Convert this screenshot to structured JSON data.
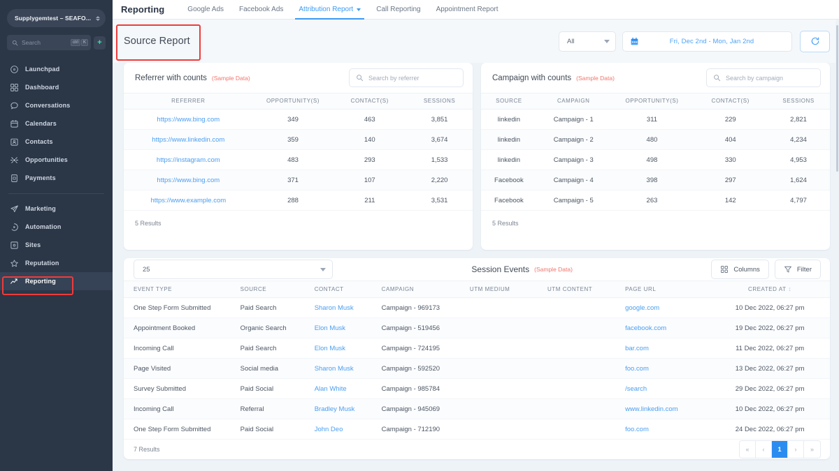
{
  "sidebar": {
    "org_name": "Supplygemtest – SEAFO...",
    "search_placeholder": "Search",
    "kbd": [
      "ctrl",
      "K"
    ],
    "add_label": "+",
    "items": [
      {
        "label": "Launchpad",
        "icon": "rocket-icon"
      },
      {
        "label": "Dashboard",
        "icon": "grid-icon"
      },
      {
        "label": "Conversations",
        "icon": "chat-bubble-icon"
      },
      {
        "label": "Calendars",
        "icon": "calendar-icon"
      },
      {
        "label": "Contacts",
        "icon": "contact-card-icon"
      },
      {
        "label": "Opportunities",
        "icon": "opportunities-icon"
      },
      {
        "label": "Payments",
        "icon": "payments-icon"
      }
    ],
    "items2": [
      {
        "label": "Marketing",
        "icon": "paper-plane-icon"
      },
      {
        "label": "Automation",
        "icon": "play-circle-icon"
      },
      {
        "label": "Sites",
        "icon": "sites-icon"
      },
      {
        "label": "Reputation",
        "icon": "star-icon"
      },
      {
        "label": "Reporting",
        "icon": "trend-line-icon",
        "active": true
      }
    ]
  },
  "topbar": {
    "title": "Reporting",
    "tabs": [
      {
        "label": "Google Ads",
        "active": false
      },
      {
        "label": "Facebook Ads",
        "active": false
      },
      {
        "label": "Attribution Report",
        "active": true,
        "has_caret": true
      },
      {
        "label": "Call Reporting",
        "active": false
      },
      {
        "label": "Appointment Report",
        "active": false
      }
    ]
  },
  "header": {
    "page_title": "Source Report",
    "filter_select_value": "All",
    "date_range": "Fri, Dec 2nd - Mon, Jan 2nd",
    "refresh_icon": "refresh-icon"
  },
  "referrer_card": {
    "title": "Referrer with counts",
    "sample_tag": "(Sample Data)",
    "search_placeholder": "Search by referrer",
    "columns": [
      "REFERRER",
      "OPPORTUNITY(S)",
      "CONTACT(S)",
      "SESSIONS"
    ],
    "rows": [
      {
        "referrer": "https://www.bing.com",
        "opportunities": "349",
        "contacts": "463",
        "sessions": "3,851"
      },
      {
        "referrer": "https://www.linkedin.com",
        "opportunities": "359",
        "contacts": "140",
        "sessions": "3,674"
      },
      {
        "referrer": "https://instagram.com",
        "opportunities": "483",
        "contacts": "293",
        "sessions": "1,533"
      },
      {
        "referrer": "https://www.bing.com",
        "opportunities": "371",
        "contacts": "107",
        "sessions": "2,220"
      },
      {
        "referrer": "https://www.example.com",
        "opportunities": "288",
        "contacts": "211",
        "sessions": "3,531"
      }
    ],
    "results": "5 Results"
  },
  "campaign_card": {
    "title": "Campaign with counts",
    "sample_tag": "(Sample Data)",
    "search_placeholder": "Search by campaign",
    "columns": [
      "SOURCE",
      "CAMPAIGN",
      "OPPORTUNITY(S)",
      "CONTACT(S)",
      "SESSIONS"
    ],
    "rows": [
      {
        "source": "linkedin",
        "campaign": "Campaign - 1",
        "opportunities": "311",
        "contacts": "229",
        "sessions": "2,821"
      },
      {
        "source": "linkedin",
        "campaign": "Campaign - 2",
        "opportunities": "480",
        "contacts": "404",
        "sessions": "4,234"
      },
      {
        "source": "linkedin",
        "campaign": "Campaign - 3",
        "opportunities": "498",
        "contacts": "330",
        "sessions": "4,953"
      },
      {
        "source": "Facebook",
        "campaign": "Campaign - 4",
        "opportunities": "398",
        "contacts": "297",
        "sessions": "1,624"
      },
      {
        "source": "Facebook",
        "campaign": "Campaign - 5",
        "opportunities": "263",
        "contacts": "142",
        "sessions": "4,797"
      }
    ],
    "results": "5 Results"
  },
  "session_events": {
    "title": "Session Events",
    "sample_tag": "(Sample Data)",
    "page_size": "25",
    "columns_button": "Columns",
    "filter_button": "Filter",
    "columns": [
      "EVENT TYPE",
      "SOURCE",
      "CONTACT",
      "CAMPAIGN",
      "UTM MEDIUM",
      "UTM CONTENT",
      "PAGE URL",
      "CREATED AT"
    ],
    "rows": [
      {
        "event_type": "One Step Form Submitted",
        "source": "Paid Search",
        "contact": "Sharon Musk",
        "campaign": "Campaign - 969173",
        "utm_medium": "",
        "utm_content": "",
        "page_url": "google.com",
        "created_at": "10 Dec 2022, 06:27 pm"
      },
      {
        "event_type": "Appointment Booked",
        "source": "Organic Search",
        "contact": "Elon Musk",
        "campaign": "Campaign - 519456",
        "utm_medium": "",
        "utm_content": "",
        "page_url": "facebook.com",
        "created_at": "19 Dec 2022, 06:27 pm"
      },
      {
        "event_type": "Incoming Call",
        "source": "Paid Search",
        "contact": "Elon Musk",
        "campaign": "Campaign - 724195",
        "utm_medium": "",
        "utm_content": "",
        "page_url": "bar.com",
        "created_at": "11 Dec 2022, 06:27 pm"
      },
      {
        "event_type": "Page Visited",
        "source": "Social media",
        "contact": "Sharon Musk",
        "campaign": "Campaign - 592520",
        "utm_medium": "",
        "utm_content": "",
        "page_url": "foo.com",
        "created_at": "13 Dec 2022, 06:27 pm"
      },
      {
        "event_type": "Survey Submitted",
        "source": "Paid Social",
        "contact": "Alan White",
        "campaign": "Campaign - 985784",
        "utm_medium": "",
        "utm_content": "",
        "page_url": "/search",
        "created_at": "29 Dec 2022, 06:27 pm"
      },
      {
        "event_type": "Incoming Call",
        "source": "Referral",
        "contact": "Bradley Musk",
        "campaign": "Campaign - 945069",
        "utm_medium": "",
        "utm_content": "",
        "page_url": "www.linkedin.com",
        "created_at": "10 Dec 2022, 06:27 pm"
      },
      {
        "event_type": "One Step Form Submitted",
        "source": "Paid Social",
        "contact": "John Deo",
        "campaign": "Campaign - 712190",
        "utm_medium": "",
        "utm_content": "",
        "page_url": "foo.com",
        "created_at": "24 Dec 2022, 06:27 pm"
      }
    ],
    "results": "7 Results",
    "pagination": {
      "first": "«",
      "prev": "‹",
      "current": "1",
      "next": "›",
      "last": "»"
    }
  },
  "colors": {
    "sidebar_bg": "#2b3647",
    "accent_blue": "#3b9bf5",
    "link_blue": "#4a9ef0",
    "sample_red": "#f2756c",
    "annotation_red": "#ef3b3b",
    "page_bg": "#eef3f8",
    "pager_active": "#2b8cf0"
  }
}
